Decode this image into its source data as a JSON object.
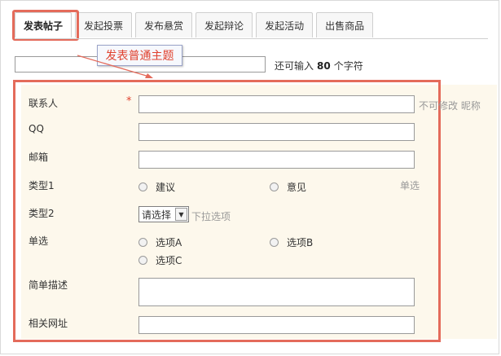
{
  "tabs": [
    {
      "label": "发表帖子",
      "active": true
    },
    {
      "label": "发起投票",
      "active": false
    },
    {
      "label": "发布悬赏",
      "active": false
    },
    {
      "label": "发起辩论",
      "active": false
    },
    {
      "label": "发起活动",
      "active": false
    },
    {
      "label": "出售商品",
      "active": false
    }
  ],
  "tooltip": {
    "text": "发表普通主题"
  },
  "title_field": {
    "value": "",
    "counter_prefix": "还可输入",
    "counter_value": "80",
    "counter_suffix": "个字符"
  },
  "form": {
    "contact": {
      "label": "联系人",
      "required_mark": "*",
      "value": "",
      "hint": "不可修改 昵称"
    },
    "qq": {
      "label": "QQ",
      "value": ""
    },
    "email": {
      "label": "邮箱",
      "value": ""
    },
    "type1": {
      "label": "类型1",
      "options": [
        "建议",
        "意见"
      ],
      "hint": "单选"
    },
    "type2": {
      "label": "类型2",
      "selected": "请选择",
      "hint": "下拉选项"
    },
    "single": {
      "label": "单选",
      "options": [
        "选项A",
        "选项B",
        "选项C"
      ]
    },
    "description": {
      "label": "简单描述",
      "value": ""
    },
    "url": {
      "label": "相关网址",
      "value": ""
    }
  },
  "colors": {
    "highlight": "#e46b5b",
    "tooltip_text": "#e0422f",
    "form_bg": "#fdf8ec"
  }
}
